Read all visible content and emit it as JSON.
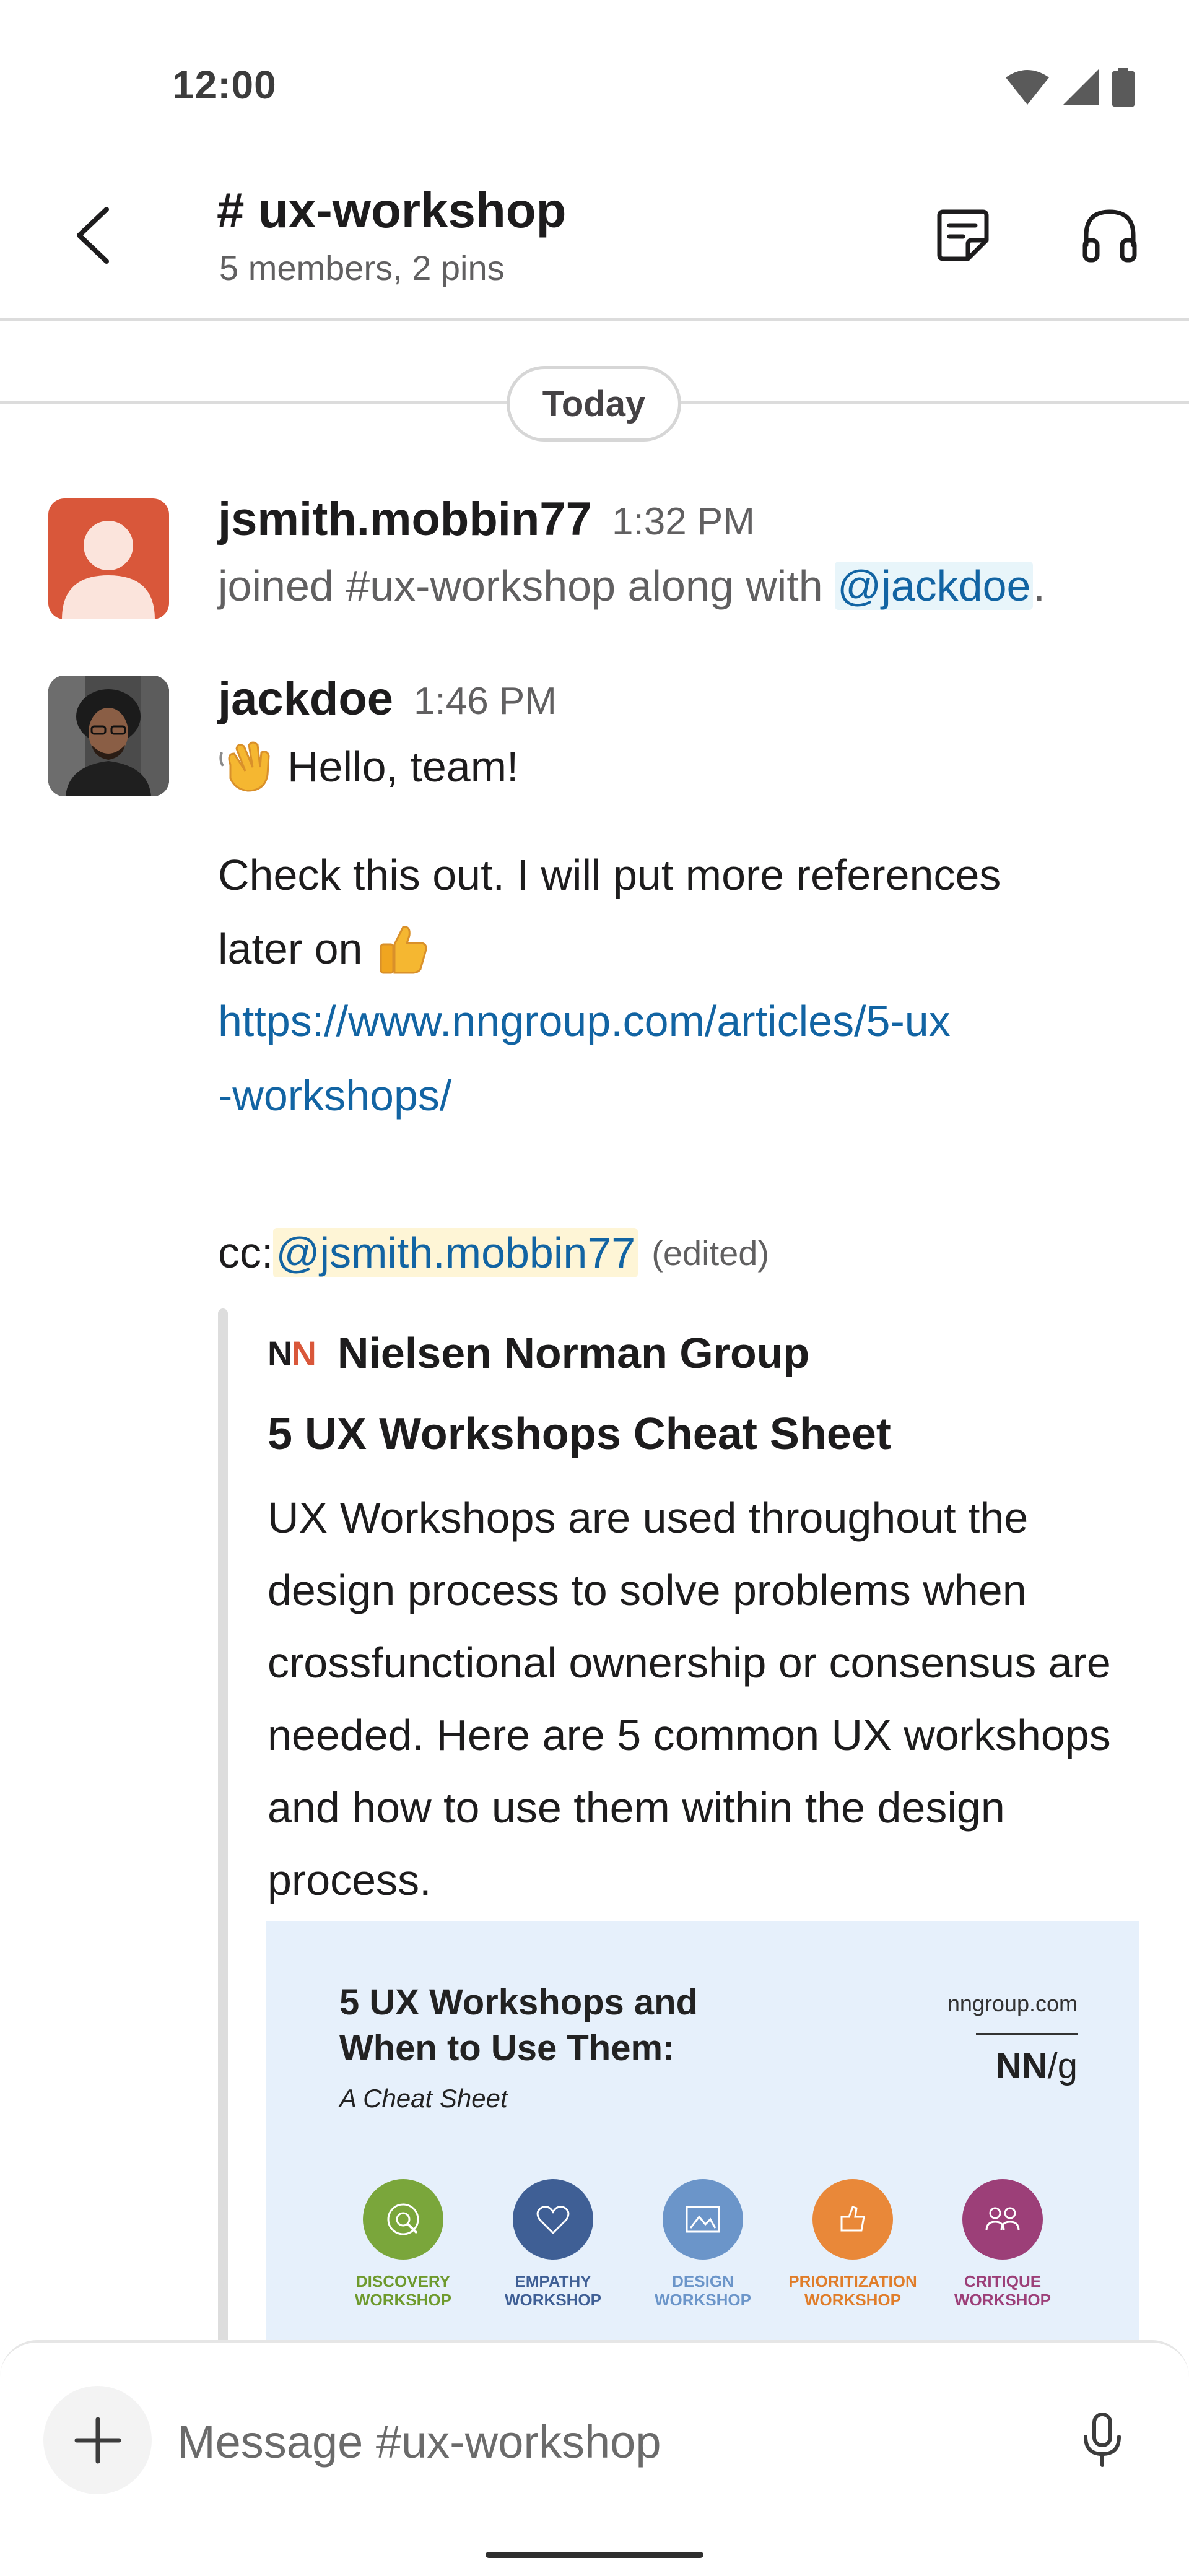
{
  "status_bar": {
    "time": "12:00"
  },
  "header": {
    "channel_name": "# ux-workshop",
    "subtitle": "5 members, 2 pins"
  },
  "feed": {
    "day_divider": "Today",
    "messages": [
      {
        "author": "jsmith.mobbin77",
        "time": "1:32 PM",
        "text_before_mention": "joined #ux-workshop along with ",
        "mention": "@jackdoe",
        "text_after_mention": "."
      },
      {
        "author": "jackdoe",
        "time": "1:46 PM",
        "hello": "Hello, team!",
        "check_line1": "Check this out. I will put more references",
        "check_line2": "later on",
        "link_line1": "https://www.nngroup.com/articles/5-ux",
        "link_line2": "-workshops/",
        "cc_label": "cc: ",
        "cc_mention": "@jsmith.mobbin77",
        "edited": "(edited)"
      }
    ],
    "unfurl": {
      "logo_n1": "N",
      "logo_n2": "N",
      "source": "Nielsen Norman Group",
      "title": "5 UX Workshops Cheat Sheet",
      "description": "UX Workshops are used throughout the design process to solve problems when crossfunctional ownership or consensus are needed. Here are 5 common UX workshops and how to use them within the design process.",
      "preview": {
        "title": "5 UX Workshops and When to Use Them:",
        "subtitle": "A Cheat Sheet",
        "site": "nngroup.com",
        "brand_main": "NN",
        "brand_slash": "/g",
        "workshops": [
          {
            "label": "DISCOVERY WORKSHOP",
            "color": "#7aa63b",
            "text_color": "#6e9a2d"
          },
          {
            "label": "EMPATHY WORKSHOP",
            "color": "#3f5f95",
            "text_color": "#3f5f95"
          },
          {
            "label": "DESIGN WORKSHOP",
            "color": "#6b95c9",
            "text_color": "#6b95c9"
          },
          {
            "label": "PRIORITIZATION WORKSHOP",
            "color": "#e98839",
            "text_color": "#e07d2a"
          },
          {
            "label": "CRITIQUE WORKSHOP",
            "color": "#9c3f78",
            "text_color": "#9c3f78"
          }
        ]
      }
    }
  },
  "composer": {
    "placeholder": "Message #ux-workshop"
  },
  "colors": {
    "link": "#1264a3",
    "avatar_orange": "#d9573a"
  }
}
